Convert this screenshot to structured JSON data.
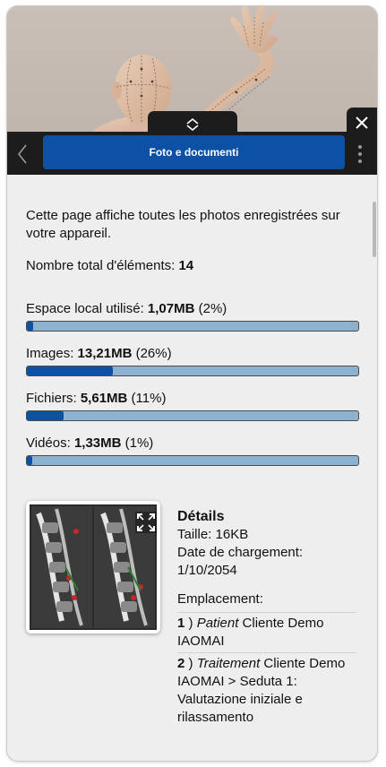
{
  "header": {
    "title": "Foto e documenti"
  },
  "intro": "Cette page affiche toutes les photos enregistrées sur votre appareil.",
  "total": {
    "label": "Nombre total d'éléments: ",
    "value": "14"
  },
  "stats": [
    {
      "label": "Espace local utilisé: ",
      "value": "1,07MB",
      "pct_text": " (2%)",
      "fill": 0.02
    },
    {
      "label": "Images: ",
      "value": "13,21MB",
      "pct_text": " (26%)",
      "fill": 0.26
    },
    {
      "label": "Fichiers: ",
      "value": "5,61MB",
      "pct_text": " (11%)",
      "fill": 0.11
    },
    {
      "label": "Vidéos: ",
      "value": "1,33MB",
      "pct_text": " (1%)",
      "fill": 0.01
    }
  ],
  "details": {
    "heading": "Détails",
    "size": "Taille: 16KB",
    "upload_label": "Date de chargement:",
    "upload_date": "1/10/2054",
    "location_label": "Emplacement:",
    "locations": [
      {
        "num": "1",
        "sep": " ) ",
        "type": "Patient",
        "text": " Cliente Demo IAOMAI"
      },
      {
        "num": "2",
        "sep": " ) ",
        "type": "Traitement",
        "text": " Cliente Demo IAOMAI > Seduta 1: Valutazione iniziale e rilassamento"
      }
    ]
  },
  "colors": {
    "accent": "#0d51a6",
    "bar_track": "#8cb2cf",
    "topbar": "#1c1c1c",
    "panel": "#eeeeee"
  },
  "icons": [
    "chevron-left-icon",
    "chevron-up-down-icon",
    "close-icon",
    "more-vertical-icon",
    "expand-icon"
  ]
}
